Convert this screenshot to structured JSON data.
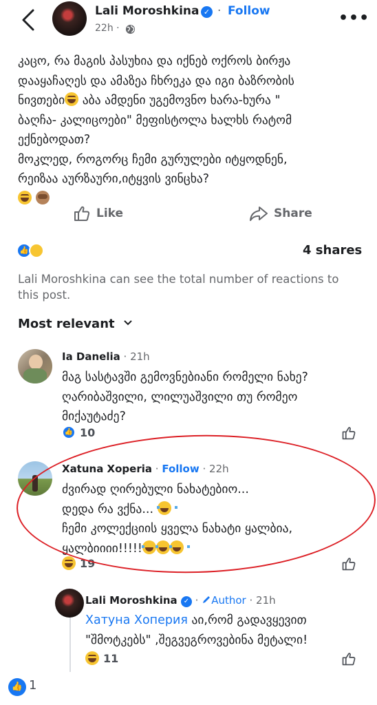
{
  "header": {
    "author": "Lali Moroshkina",
    "dot": "·",
    "follow": "Follow",
    "time": "22h ·",
    "more": "•••"
  },
  "post": {
    "lines": [
      "კაცო, რა მაგის პასუხია და  იქნებ ოქროს ბირჟა",
      "დააყაჩაღეს და ამაზეა ჩხრეკა და იგი ბაზრობის",
      "ნივთები",
      " აბა ამდენი უგემოვნო ხარა-ხურა \"",
      "ბაღჩა- კალიცოები\" მეფისტოლა ხალხს რატომ",
      "ექნებოდათ?",
      "მოკლედ, როგორც ჩემი გურულები  იტყოდნენ,",
      "რეიზაა აურზაური,იტყვის ვინცხა?"
    ],
    "like_label": "Like",
    "share_label": "Share"
  },
  "stats": {
    "shares": "4 shares",
    "note": "Lali Moroshkina can see the total number of reactions to this post."
  },
  "comments": {
    "sort_label": "Most relevant",
    "items": [
      {
        "name": "Ia Danelia",
        "meta": " · 21h",
        "lines": [
          "მაგ სასტავში გემოვნებიანი რომელი ნახე?",
          "ღარიბაშვილი, ლილუაშვილი თუ რომეო",
          "მიქაუტაძე?"
        ],
        "reactions": "10"
      },
      {
        "name": "Xatuna Xoperia",
        "dot": " · ",
        "follow": "Follow",
        "meta": " · 22h",
        "lines": [
          "ძვირად ღირებული ნახატებიო...",
          "დედა რა ვქნა... ",
          "ჩემი კოლექციის ყველა ნახატი ყალბია,",
          "ყალბიიიი!!!!!"
        ],
        "reactions": "19"
      }
    ],
    "reply": {
      "name": "Lali Moroshkina",
      "dot": " · ",
      "badge": "Author",
      "meta": " · 21h",
      "mention": "Хатуна Хоперия",
      "line1_rest": " აი,რომ გადავყევით",
      "line2": "\"შმოტკებს\" ,შეგვეგროვებინა მეტალი!",
      "reactions": "11"
    }
  },
  "footer": {
    "like_count": "1"
  },
  "colors": {
    "brand_blue": "#1877f2",
    "annotation_red": "#dc1f25"
  }
}
